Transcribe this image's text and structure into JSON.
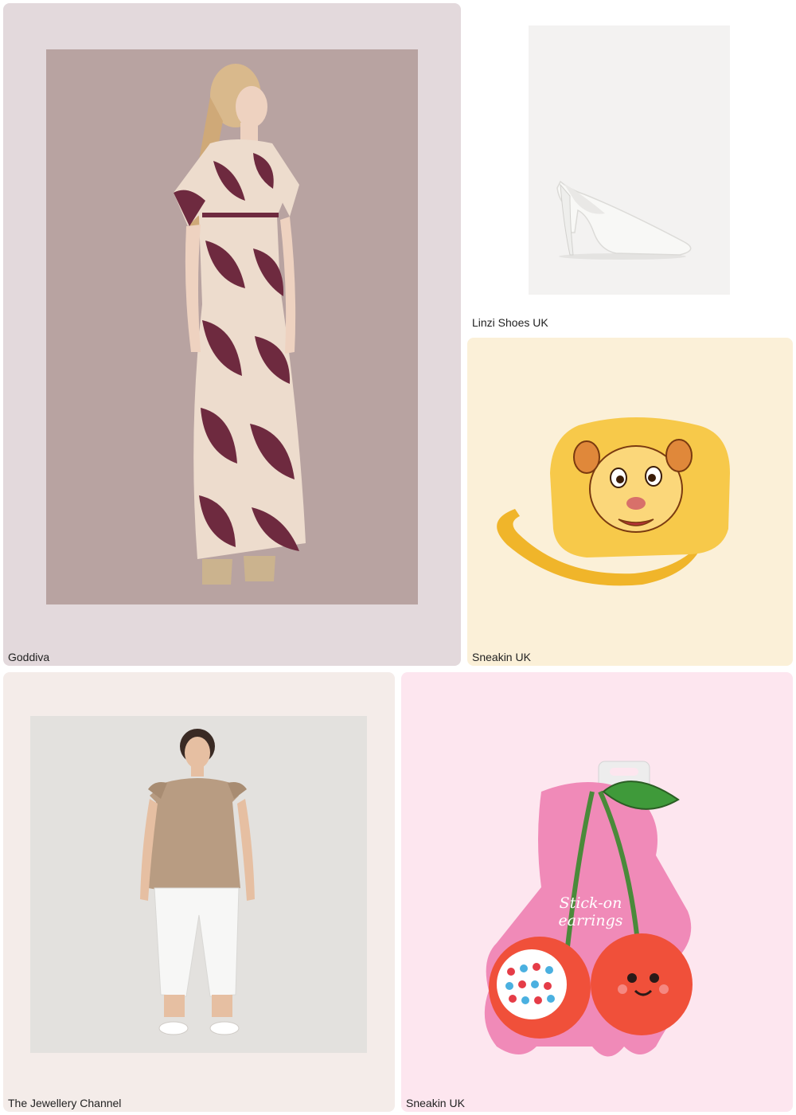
{
  "tiles": [
    {
      "brand": "Goddiva",
      "image": "floral-maxi-dress-photo"
    },
    {
      "brand": "Linzi Shoes UK",
      "image": "white-stiletto-pump-photo"
    },
    {
      "brand": "Sneakin UK",
      "image": "lion-plush-crossbody-bag-photo"
    },
    {
      "brand": "The Jewellery Channel",
      "image": "frill-sleeve-top-photo"
    },
    {
      "brand": "Sneakin UK",
      "image": "cherry-earrings-card-photo",
      "product_text": [
        "Stick-on",
        "earrings"
      ]
    }
  ],
  "colors": {
    "tile1_bg": "#e3d9dc",
    "tile3_bg": "#fbf0d8",
    "tile4_bg": "#f4ece9",
    "tile5_bg": "#fde6ef",
    "dress_print": "#6e2a3f",
    "cherry_card": "#f08ab8",
    "cherry_red": "#f0503a"
  }
}
